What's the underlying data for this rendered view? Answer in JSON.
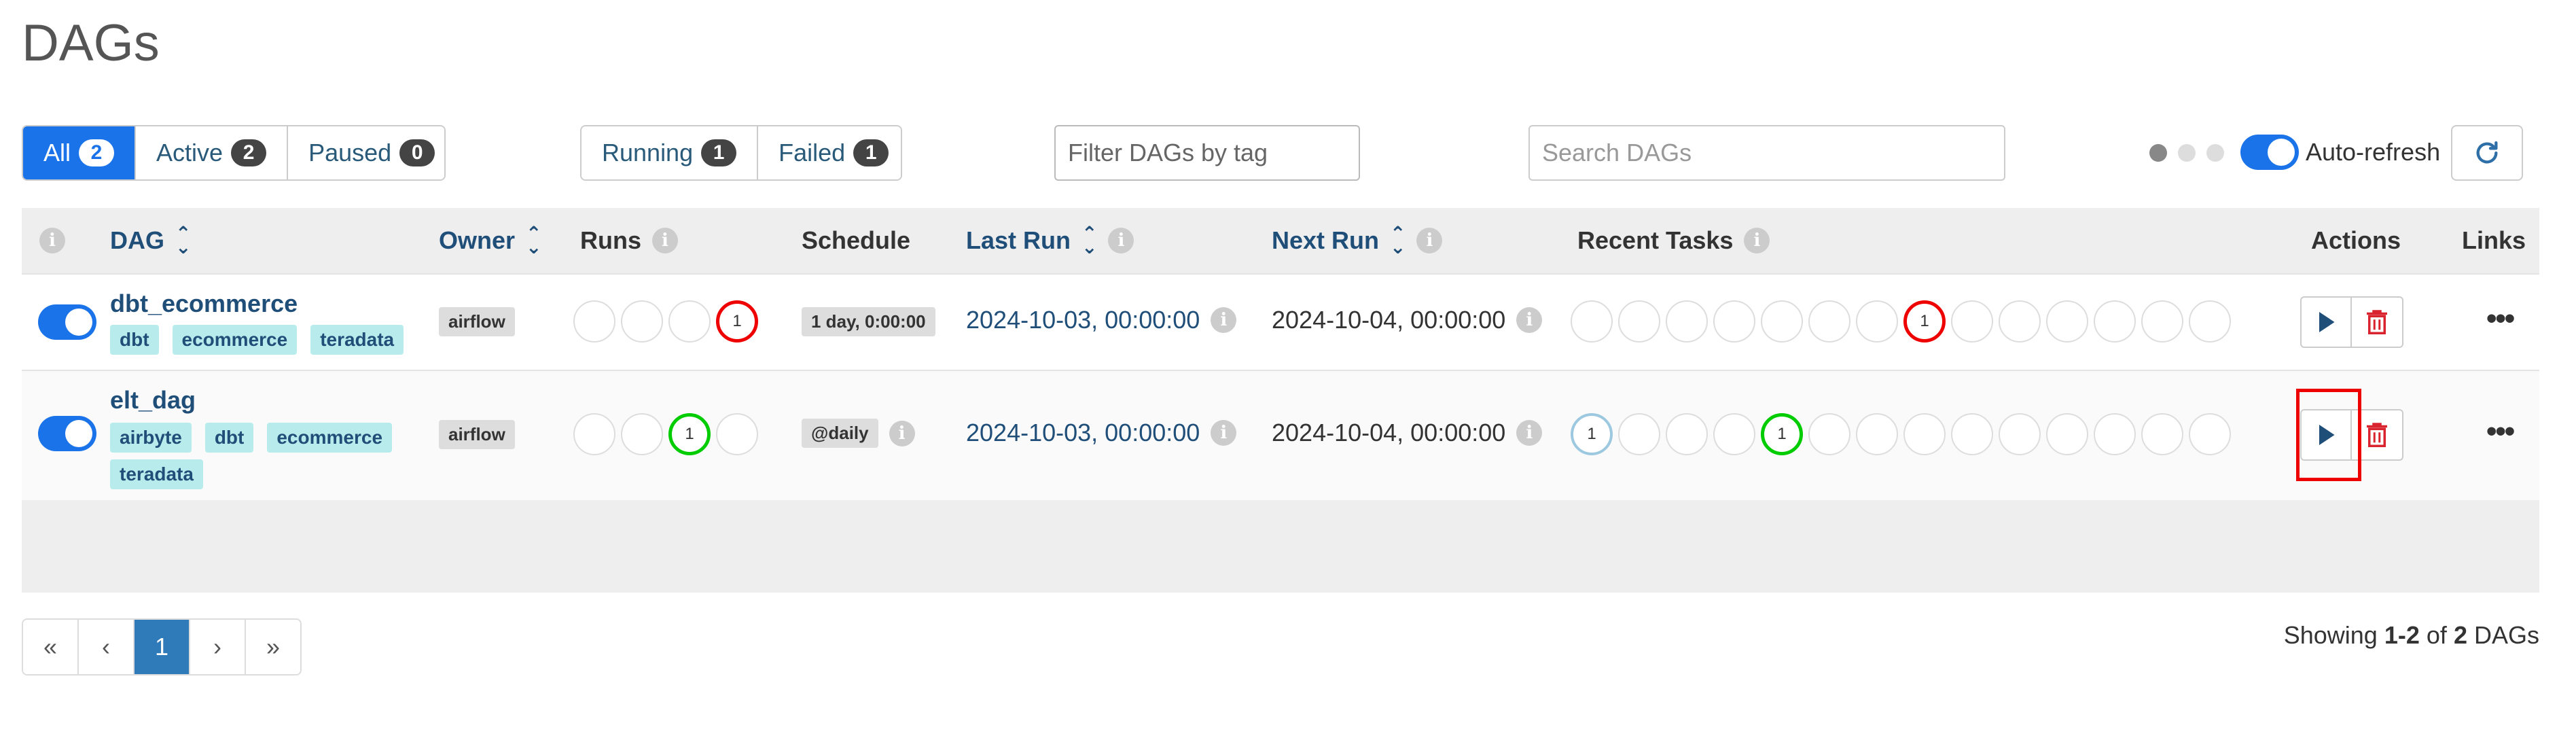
{
  "page": {
    "title": "DAGs"
  },
  "status_filters": [
    {
      "label": "All",
      "count": "2",
      "active": true
    },
    {
      "label": "Active",
      "count": "2"
    },
    {
      "label": "Paused",
      "count": "0"
    }
  ],
  "run_filters": [
    {
      "label": "Running",
      "count": "1"
    },
    {
      "label": "Failed",
      "count": "1"
    }
  ],
  "tag_filter": {
    "placeholder": "Filter DAGs by tag"
  },
  "search": {
    "placeholder": "Search DAGs"
  },
  "auto_refresh": {
    "label": "Auto-refresh",
    "enabled": true
  },
  "table": {
    "headers": {
      "info": "i",
      "dag": "DAG",
      "owner": "Owner",
      "runs": "Runs",
      "schedule": "Schedule",
      "last_run": "Last Run",
      "next_run": "Next Run",
      "recent_tasks": "Recent Tasks",
      "actions": "Actions",
      "links": "Links"
    },
    "rows": [
      {
        "name": "dbt_ecommerce",
        "active": true,
        "tags": [
          "dbt",
          "ecommerce",
          "teradata"
        ],
        "owner": "airflow",
        "runs": [
          "",
          "",
          "",
          "1"
        ],
        "runs_states": [
          "none",
          "none",
          "none",
          "failed"
        ],
        "schedule": "1 day, 0:00:00",
        "last_run": "2024-10-03, 00:00:00",
        "next_run": "2024-10-04, 00:00:00",
        "recent_tasks_states": [
          "none",
          "none",
          "none",
          "none",
          "none",
          "none",
          "none",
          "failed",
          "none",
          "none",
          "none",
          "none",
          "none",
          "none"
        ],
        "recent_tasks_counts": [
          "",
          "",
          "",
          "",
          "",
          "",
          "",
          "1",
          "",
          "",
          "",
          "",
          "",
          ""
        ]
      },
      {
        "name": "elt_dag",
        "active": true,
        "tags": [
          "airbyte",
          "dbt",
          "ecommerce",
          "teradata"
        ],
        "owner": "airflow",
        "runs": [
          "",
          "",
          "1",
          ""
        ],
        "runs_states": [
          "none",
          "none",
          "success",
          "none"
        ],
        "schedule": "@daily",
        "last_run": "2024-10-03, 00:00:00",
        "next_run": "2024-10-04, 00:00:00",
        "recent_tasks_states": [
          "queued",
          "none",
          "none",
          "none",
          "success",
          "none",
          "none",
          "none",
          "none",
          "none",
          "none",
          "none",
          "none",
          "none"
        ],
        "recent_tasks_counts": [
          "1",
          "",
          "",
          "",
          "1",
          "",
          "",
          "",
          "",
          "",
          "",
          "",
          "",
          ""
        ]
      }
    ]
  },
  "pagination": {
    "first": "«",
    "prev": "‹",
    "current": "1",
    "next": "›",
    "last": "»"
  },
  "showing": {
    "prefix": "Showing",
    "range": "1-2",
    "of": "of",
    "total": "2",
    "suffix": "DAGs"
  },
  "colors": {
    "primary": "#1a73e8",
    "failed": "#e00000",
    "success": "#00cc00",
    "queued": "#9cc8e0",
    "tag_bg": "#b8ecec",
    "link": "#1f4e79"
  },
  "icons": {
    "refresh": "refresh-icon",
    "trigger": "play-icon",
    "delete": "trash-icon",
    "more": "more-icon",
    "info": "info-icon"
  }
}
